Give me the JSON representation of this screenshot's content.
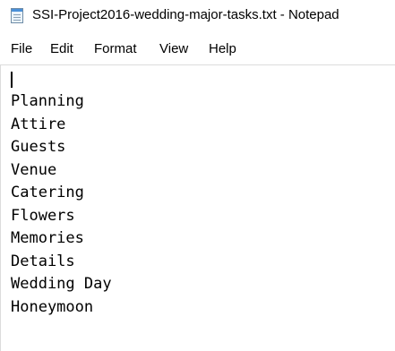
{
  "window": {
    "title": "SSI-Project2016-wedding-major-tasks.txt - Notepad",
    "icon": "notepad-icon"
  },
  "menu": {
    "file": "File",
    "edit": "Edit",
    "format": "Format",
    "view": "View",
    "help": "Help"
  },
  "editor": {
    "lines": [
      "Planning",
      "Attire",
      "Guests",
      "Venue",
      "Catering",
      "Flowers",
      "Memories",
      "Details",
      "Wedding Day",
      "Honeymoon"
    ]
  }
}
